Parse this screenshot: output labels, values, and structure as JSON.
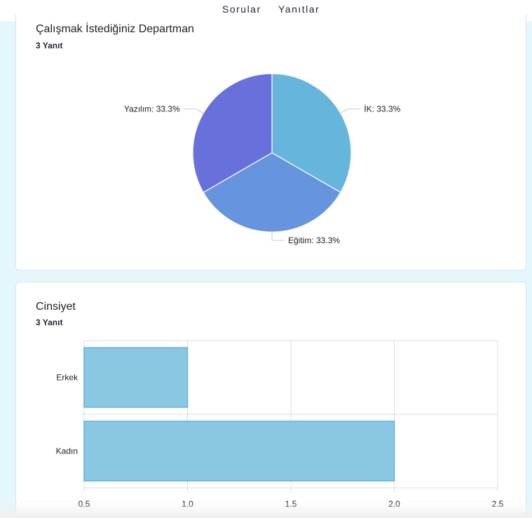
{
  "tabs": [
    {
      "label": "Sorular"
    },
    {
      "label": "Yanıtlar",
      "active": true
    }
  ],
  "colors": {
    "accent": "#4fb7de",
    "bar": "#84c4e1",
    "bar_border": "#5eb1d8"
  },
  "cards": [
    {
      "title": "Çalışmak İstediğiniz Departman",
      "count": "3 Yanıt",
      "chart_data": {
        "type": "pie",
        "slices": [
          {
            "label": "İK",
            "value": 33.3,
            "text": "İK: 33.3%",
            "color": "#65b5dc"
          },
          {
            "label": "Eğitim",
            "value": 33.3,
            "text": "Eğitim: 33.3%",
            "color": "#6794de"
          },
          {
            "label": "Yazılım",
            "value": 33.3,
            "text": "Yazılım: 33.3%",
            "color": "#6870dc"
          }
        ]
      }
    },
    {
      "title": "Cinsiyet",
      "count": "3 Yanıt",
      "chart_data": {
        "type": "bar",
        "orientation": "horizontal",
        "categories": [
          "Erkek",
          "Kadın"
        ],
        "values": [
          1,
          2
        ],
        "xlim": [
          0.5,
          2.5
        ],
        "xticks": [
          "0.5",
          "1.0",
          "1.5",
          "2.0",
          "2.5"
        ],
        "grid": true
      }
    }
  ]
}
